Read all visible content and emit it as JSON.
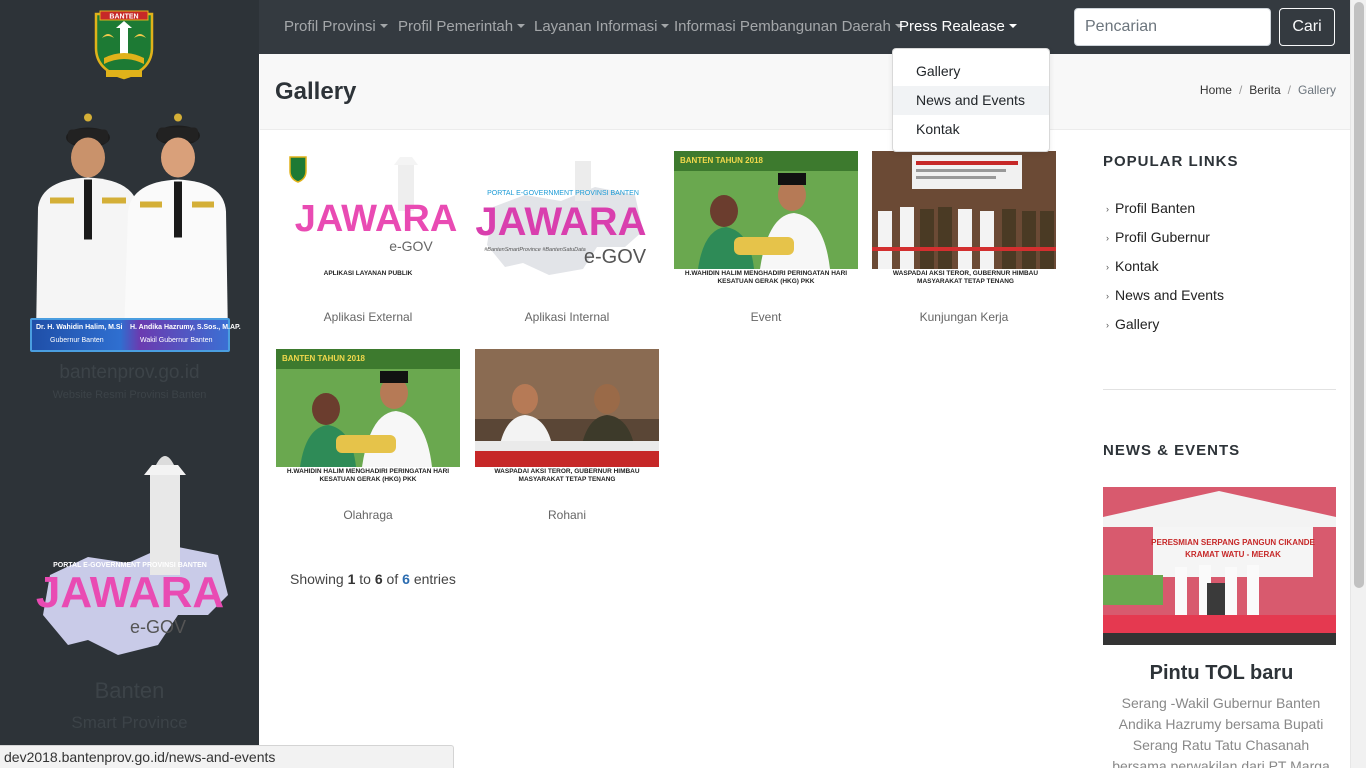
{
  "sidebar": {
    "emblem_text": "BANTEN",
    "governor_name": "Dr. H. Wahidin Halim, M.Si",
    "governor_role": "Gubernur Banten",
    "vice_name": "H. Andika Hazrumy, S.Sos., M.AP.",
    "vice_role": "Wakil Gubernur Banten",
    "site_name": "bantenprov.go.id",
    "site_desc": "Website Resmi Provinsi Banten",
    "portal_line": "PORTAL E-GOVERNMENT PROVINSI BANTEN",
    "portal_brand": "JAWARA",
    "portal_egov": "e-GOV",
    "title": "Banten",
    "subtitle": "Smart Province"
  },
  "navbar": {
    "items": [
      {
        "label": "Profil Provinsi"
      },
      {
        "label": "Profil Pemerintah"
      },
      {
        "label": "Layanan Informasi"
      },
      {
        "label": "Informasi Pembangunan Daerah"
      },
      {
        "label": "Press Realease"
      }
    ],
    "search_placeholder": "Pencarian",
    "search_button": "Cari"
  },
  "dropdown": {
    "items": [
      {
        "label": "Gallery"
      },
      {
        "label": "News and Events"
      },
      {
        "label": "Kontak"
      }
    ],
    "hovered": "News and Events"
  },
  "page": {
    "title": "Gallery",
    "breadcrumb": [
      "Home",
      "Berita",
      "Gallery"
    ]
  },
  "gallery": {
    "items": [
      {
        "caption": "Aplikasi External",
        "image_text": "APLIKASI LAYANAN PUBLIK"
      },
      {
        "caption": "Aplikasi Internal",
        "image_text": "#BantenSmartProvince #BantenSatuData"
      },
      {
        "caption": "Event",
        "image_text": "H.WAHIDIN HALIM MENGHADIRI PERINGATAN HARI KESATUAN GERAK (HKG) PKK"
      },
      {
        "caption": "Kunjungan Kerja",
        "image_text": "WASPADAI AKSI TEROR, GUBERNUR HIMBAU MASYARAKAT TETAP TENANG"
      },
      {
        "caption": "Olahraga",
        "image_text": "H.WAHIDIN HALIM MENGHADIRI PERINGATAN HARI KESATUAN GERAK (HKG) PKK"
      },
      {
        "caption": "Rohani",
        "image_text": "WASPADAI AKSI TEROR, GUBERNUR HIMBAU MASYARAKAT TETAP TENANG"
      }
    ],
    "photo_banner": "BANTEN TAHUN 2018",
    "showing_prefix": "Showing",
    "showing_from": "1",
    "showing_to_word": "to",
    "showing_to": "6",
    "showing_of_word": "of",
    "showing_total": "6",
    "showing_suffix": "entries"
  },
  "popular_links": {
    "title": "POPULAR LINKS",
    "items": [
      {
        "label": "Profil Banten"
      },
      {
        "label": "Profil Gubernur"
      },
      {
        "label": "Kontak"
      },
      {
        "label": "News and Events"
      },
      {
        "label": "Gallery"
      }
    ]
  },
  "news_events": {
    "title": "NEWS & EVENTS",
    "item_title": "Pintu TOL baru",
    "item_text": "Serang -Wakil Gubernur Banten Andika Hazrumy bersama Bupati Serang Ratu Tatu Chasanah bersama perwakilan dari PT Marga"
  },
  "status_url": "dev2018.bantenprov.go.id/news-and-events",
  "colors": {
    "sidebar_bg": "#2d3338",
    "navbar_bg": "#343a40",
    "link_blue": "#2b6cb0"
  }
}
